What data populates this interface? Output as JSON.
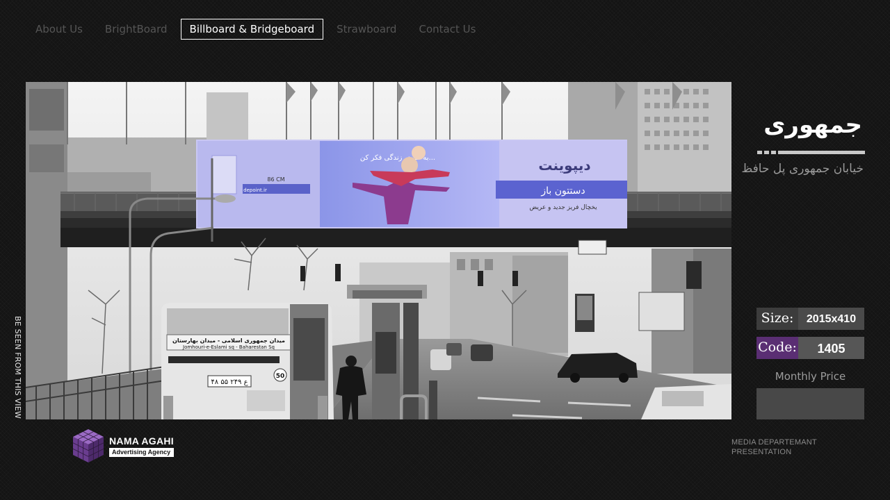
{
  "nav": {
    "items": [
      "About Us",
      "BrightBoard",
      "Billboard & Bridgeboard",
      "Strawboard",
      "Contact Us"
    ],
    "active": "Billboard & Bridgeboard"
  },
  "photo": {
    "side_label": "BE SEEN FROM THIS VIEW",
    "ad": {
      "headline": "به عرض زندگی فکر کن...",
      "brand": "دیپوینت",
      "slogan": "دستتون باز",
      "tagline": "یخچال فریز جدید و عریض",
      "measure": "86 CM",
      "site": "depoint.ir"
    },
    "bus": {
      "sign_fa": "میدان جمهوری اسلامی - میدان بهارستان",
      "sign_en": "Jomhouri-e-Eslami sq - Baharestan Sq",
      "route_number": "50",
      "plate": "۴۸ ع ۲۴۹ ۵۵"
    }
  },
  "location": {
    "title": "جمهوری",
    "address": "خیابان جمهوری پل حافظ"
  },
  "specs": {
    "size_label": "Size:",
    "size_value": "2015x410",
    "code_label": "Code:",
    "code_value": "1405",
    "price_label": "Monthly Price",
    "price_value": ""
  },
  "brand": {
    "name": "NAMA AGAHI",
    "tagline": "Advertising Agency"
  },
  "footer": {
    "line1": "MEDIA DEPARTEMANT",
    "line2": "PRESENTATION"
  },
  "colors": {
    "background": "#141414",
    "accent_purple": "#5a2e73",
    "value_box": "#4a4a4a",
    "ad_purple": "#8f86e6"
  }
}
